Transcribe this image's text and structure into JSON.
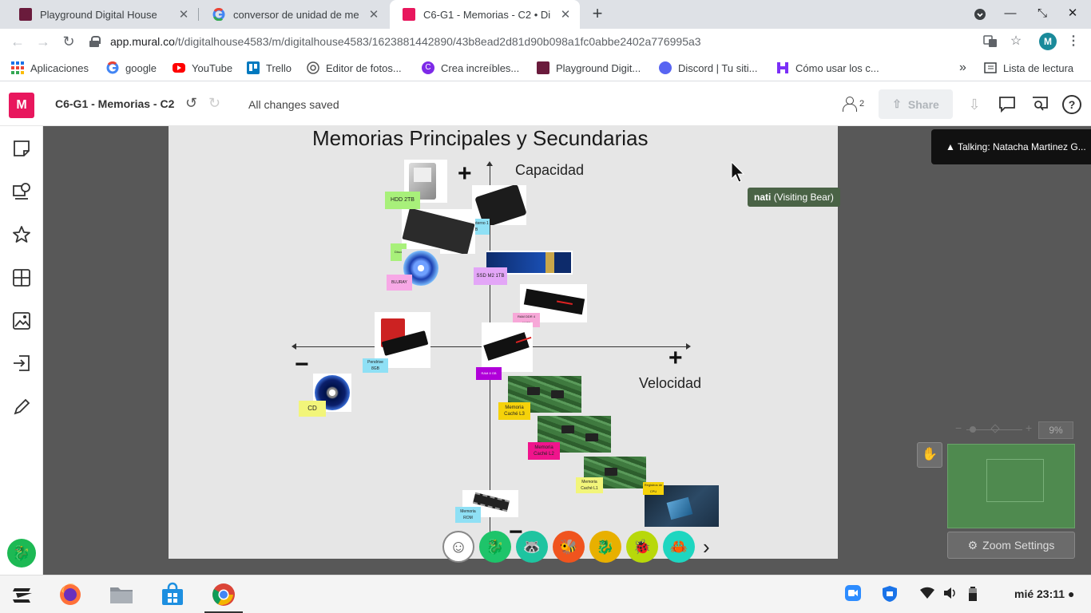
{
  "browser": {
    "tabs": [
      {
        "title": "Playground Digital House",
        "active": false
      },
      {
        "title": "conversor de unidad de me",
        "active": false
      },
      {
        "title": "C6-G1 - Memorias - C2 • Di",
        "active": true
      }
    ],
    "url_host": "app.mural.co",
    "url_path": "/t/digitalhouse4583/m/digitalhouse4583/1623881442890/43b8ead2d81d90b098a1fc0abbe2402a776995a3",
    "profile_initial": "M"
  },
  "bookmarks": {
    "apps": "Aplicaciones",
    "items": [
      "google",
      "YouTube",
      "Trello",
      "Editor de fotos...",
      "Crea increíbles...",
      "Playground Digit...",
      "Discord | Tu siti...",
      "Cómo usar los c..."
    ],
    "more": "»",
    "reading_list": "Lista de lectura"
  },
  "mural": {
    "logo": "M",
    "board_name": "C6-G1 - Memorias - C2",
    "save_status": "All changes saved",
    "collaborators": "2",
    "share_label": "Share",
    "help": "?"
  },
  "board": {
    "title": "Memorias Principales y Secundarias",
    "y_axis_label": "Capacidad",
    "x_axis_label": "Velocidad",
    "plus": "+",
    "minus": "−",
    "notes": {
      "hdd": "HDD 2TB",
      "hdd_ext": "HDD Externo 1 TB",
      "disco": "Disco",
      "bluray": "BLURAY",
      "ssd_m2": "SSD M2 1TB",
      "ram_ddr": "RAM DDR 4 16GB",
      "pendrive": "Pendrive 8GB",
      "cd": "CD",
      "ram_8": "RAM 8 GB",
      "cache_l3": "Memoria Caché L3",
      "cache_l2": "Memoria Caché L2",
      "cache_l1": "Memoria Caché L1",
      "registros": "Registros de CPU",
      "rom": "Memoria ROM"
    }
  },
  "presence": {
    "visitor_name": "nati",
    "visitor_role": "(Visiting Bear)",
    "talking": "▲  Talking: Natacha Martinez G..."
  },
  "zoom": {
    "percent": "9%",
    "settings_label": "Zoom Settings"
  },
  "taskbar": {
    "clock": "mié 23:11"
  }
}
